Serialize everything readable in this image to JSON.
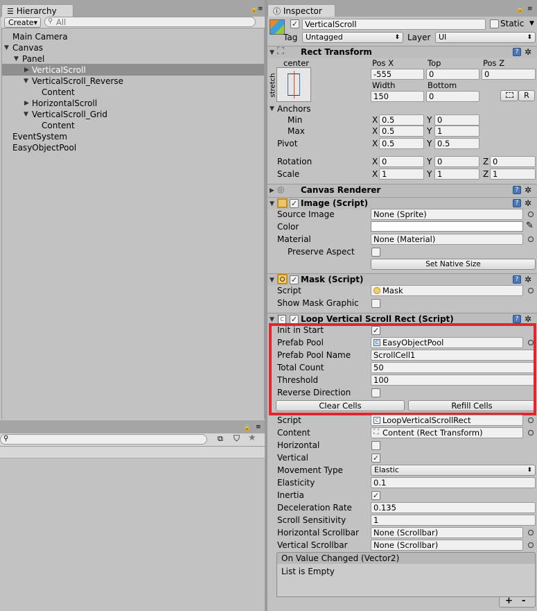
{
  "hierarchy": {
    "tab_label": "Hierarchy",
    "create_label": "Create",
    "search_placeholder": "All",
    "items": [
      {
        "label": "Main Camera"
      },
      {
        "label": "Canvas"
      },
      {
        "label": "Panel"
      },
      {
        "label": "VerticalScroll"
      },
      {
        "label": "VerticalScroll_Reverse"
      },
      {
        "label": "Content"
      },
      {
        "label": "HorizontalScroll"
      },
      {
        "label": "VerticalScroll_Grid"
      },
      {
        "label": "Content"
      },
      {
        "label": "EventSystem"
      },
      {
        "label": "EasyObjectPool"
      }
    ]
  },
  "inspector": {
    "tab_label": "Inspector",
    "object_name": "VerticalScroll",
    "static_label": "Static",
    "tag_label": "Tag",
    "tag_value": "Untagged",
    "layer_label": "Layer",
    "layer_value": "UI"
  },
  "rect_transform": {
    "title": "Rect Transform",
    "anchor_preset_label": "center",
    "stretch_label": "stretch",
    "col1": "Pos X",
    "col2": "Top",
    "col3": "Pos Z",
    "pos_x": "-555",
    "top": "0",
    "pos_z": "0",
    "width_label": "Width",
    "bottom_label": "Bottom",
    "width": "150",
    "bottom": "0",
    "r_button": "R",
    "anchors_label": "Anchors",
    "min_label": "Min",
    "min_x": "0.5",
    "min_y": "0",
    "max_label": "Max",
    "max_x": "0.5",
    "max_y": "1",
    "pivot_label": "Pivot",
    "pivot_x": "0.5",
    "pivot_y": "0.5",
    "rotation_label": "Rotation",
    "rot_x": "0",
    "rot_y": "0",
    "rot_z": "0",
    "scale_label": "Scale",
    "scale_x": "1",
    "scale_y": "1",
    "scale_z": "1",
    "x": "X",
    "y": "Y",
    "z": "Z"
  },
  "canvas_renderer": {
    "title": "Canvas Renderer"
  },
  "image": {
    "title": "Image (Script)",
    "source_image_label": "Source Image",
    "source_image": "None (Sprite)",
    "color_label": "Color",
    "material_label": "Material",
    "material": "None (Material)",
    "preserve_aspect_label": "Preserve Aspect",
    "set_native_size": "Set Native Size"
  },
  "mask": {
    "title": "Mask (Script)",
    "script_label": "Script",
    "script": "Mask",
    "show_mask_graphic_label": "Show Mask Graphic"
  },
  "loop": {
    "title": "Loop Vertical Scroll Rect (Script)",
    "init_in_start_label": "Init in Start",
    "init_in_start": true,
    "prefab_pool_label": "Prefab Pool",
    "prefab_pool": "EasyObjectPool",
    "prefab_pool_name_label": "Prefab Pool Name",
    "prefab_pool_name": "ScrollCell1",
    "total_count_label": "Total Count",
    "total_count": "50",
    "threshold_label": "Threshold",
    "threshold": "100",
    "reverse_direction_label": "Reverse Direction",
    "clear_cells": "Clear Cells",
    "refill_cells": "Refill Cells",
    "script_label": "Script",
    "script": "LoopVerticalScrollRect",
    "content_label": "Content",
    "content": "Content (Rect Transform)",
    "horizontal_label": "Horizontal",
    "vertical_label": "Vertical",
    "movement_type_label": "Movement Type",
    "movement_type": "Elastic",
    "elasticity_label": "Elasticity",
    "elasticity": "0.1",
    "inertia_label": "Inertia",
    "deceleration_rate_label": "Deceleration Rate",
    "deceleration_rate": "0.135",
    "scroll_sensitivity_label": "Scroll Sensitivity",
    "scroll_sensitivity": "1",
    "horizontal_scrollbar_label": "Horizontal Scrollbar",
    "horizontal_scrollbar": "None (Scrollbar)",
    "vertical_scrollbar_label": "Vertical Scrollbar",
    "vertical_scrollbar": "None (Scrollbar)",
    "on_value_changed": "On Value Changed (Vector2)",
    "list_empty": "List is Empty",
    "plus": "+",
    "minus": "-"
  },
  "colors": {
    "highlight": "#e3262d",
    "selection": "#8f8f8f",
    "accent": "#4b79b5"
  }
}
